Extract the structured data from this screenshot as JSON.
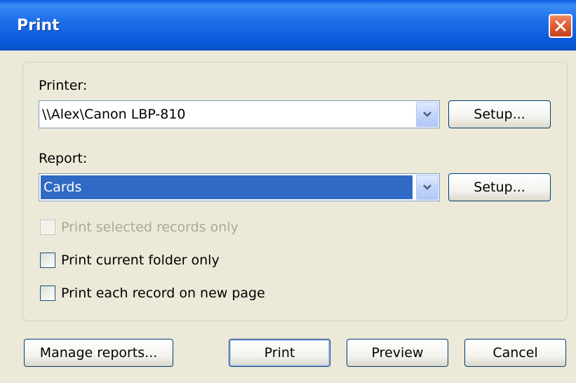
{
  "window": {
    "title": "Print"
  },
  "printer": {
    "label": "Printer:",
    "value": "\\\\Alex\\Canon LBP-810",
    "setup_label": "Setup..."
  },
  "report": {
    "label": "Report:",
    "value": "Cards",
    "setup_label": "Setup..."
  },
  "options": [
    {
      "label": "Print selected records only",
      "checked": false,
      "disabled": true
    },
    {
      "label": "Print current folder only",
      "checked": false,
      "disabled": false
    },
    {
      "label": "Print each record on new page",
      "checked": false,
      "disabled": false
    }
  ],
  "footer": {
    "manage_label": "Manage reports...",
    "print_label": "Print",
    "preview_label": "Preview",
    "cancel_label": "Cancel"
  },
  "icons": {
    "close": "close-icon",
    "dropdown": "chevron-down-icon"
  },
  "colors": {
    "titlebar": "#0A58DA",
    "close_button": "#E05A32",
    "selection": "#316AC5",
    "dialog_bg": "#ECE9D8"
  }
}
